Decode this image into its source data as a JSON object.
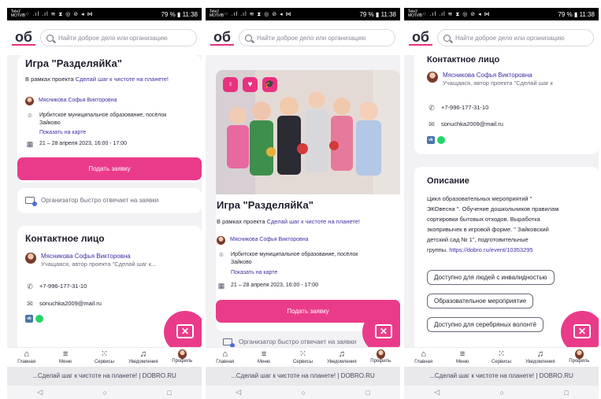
{
  "status": {
    "operator_line1": "Tele2",
    "operator_line2": "МОТИВ",
    "icons": "⁘ .ıl .ıl ≋ ⧗ ◎ ⊘ ◂ ⋈",
    "battery": "79 %",
    "battery_icon": "▮",
    "time": "11:38"
  },
  "header": {
    "logo": "об",
    "search_placeholder": "Найти доброе дело или организацию"
  },
  "event": {
    "title": "Игра \"РазделяйКа\"",
    "project_prefix": "В рамках проекта ",
    "project_link": "Сделай шаг к чистоте на планете!",
    "author": "Мясникова Софья Викторовна",
    "place_line1": "Ирбитское муниципальное образование, посёлок",
    "place_line2": "Зайково",
    "map_link": "Показать на карте",
    "dates": "21 – 28 апреля 2023, 16:00 - 17:00",
    "apply_button": "Подать заявку",
    "organizer_note": "Организатор быстро отвечает на заявки"
  },
  "contact": {
    "title": "Контактное лицо",
    "name": "Мясникова Софья Викторовна",
    "role_short": "Учащаяся, автор проекта \"Сделай шаг к...",
    "role_long": "Учащаяся, автор проекта \"Сделай шаг к",
    "phone": "+7-996-177-31-10",
    "email": "sonuchka2009@mail.ru",
    "vk": "vk"
  },
  "description": {
    "title": "Описание",
    "lines": [
      "Цикл образовательных мероприятий \"",
      "ЭКОвесна \". Обучение дошкольников правилам",
      "сортировки бытовых отходов. Выработка",
      "экопривычек в игровой форме. \" Зайковский",
      "детский сад № 1\", подготовительные"
    ],
    "last_prefix": "группы. ",
    "last_link": "https://dobro.ru/event/10353295",
    "tags": [
      "Доступно для людей с инвалидностью",
      "Образовательное мероприятие",
      "Доступно для серебряных волонтё"
    ]
  },
  "nav": {
    "items": [
      {
        "label": "Главная",
        "icon": "⌂"
      },
      {
        "label": "Меню",
        "icon": "≡"
      },
      {
        "label": "Сервисы",
        "icon": "⁙"
      },
      {
        "label": "Уведомления",
        "icon": "♫"
      },
      {
        "label": "Профиль",
        "icon": "avatar"
      }
    ]
  },
  "browser": {
    "url_text": "...Сделай шаг к чистоте на планете! | DOBRO.RU",
    "back": "◁",
    "home": "○",
    "recents": "□"
  },
  "photo_badges": [
    "♀",
    "♥",
    "🎓"
  ],
  "colors": {
    "accent": "#ea3b8a",
    "link": "#3d2fa3",
    "status_bar": "#000000"
  }
}
